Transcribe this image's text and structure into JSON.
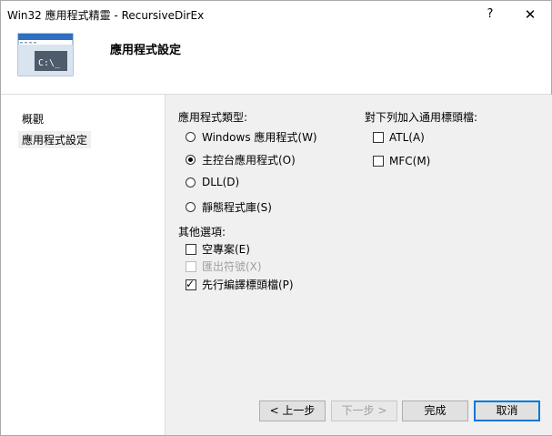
{
  "window": {
    "title": "Win32 應用程式精靈 - RecursiveDirEx",
    "help": "?",
    "close": "✕"
  },
  "header": {
    "title": "應用程式設定",
    "console_text": "C:\\_"
  },
  "nav": {
    "items": [
      {
        "label": "概觀"
      },
      {
        "label": "應用程式設定",
        "selected": true
      }
    ]
  },
  "app_type": {
    "label": "應用程式類型:",
    "options": [
      {
        "label": "Windows 應用程式(W)",
        "selected": false
      },
      {
        "label": "主控台應用程式(O)",
        "selected": true
      },
      {
        "label": "DLL(D)",
        "selected": false
      },
      {
        "label": "靜態程式庫(S)",
        "selected": false
      }
    ]
  },
  "other_options": {
    "label": "其他選項:",
    "items": [
      {
        "label": "空專案(E)",
        "checked": false,
        "enabled": true
      },
      {
        "label": "匯出符號(X)",
        "checked": false,
        "enabled": false
      },
      {
        "label": "先行編譯標頭檔(P)",
        "checked": true,
        "enabled": true
      }
    ]
  },
  "headers": {
    "label": "對下列加入通用標頭檔:",
    "items": [
      {
        "label": "ATL(A)",
        "checked": false
      },
      {
        "label": "MFC(M)",
        "checked": false
      }
    ]
  },
  "buttons": {
    "back": "< 上一步",
    "next": "下一步 >",
    "finish": "完成",
    "cancel": "取消"
  },
  "colors": {
    "accent": "#0078d7",
    "panel": "#f0f0f0"
  }
}
